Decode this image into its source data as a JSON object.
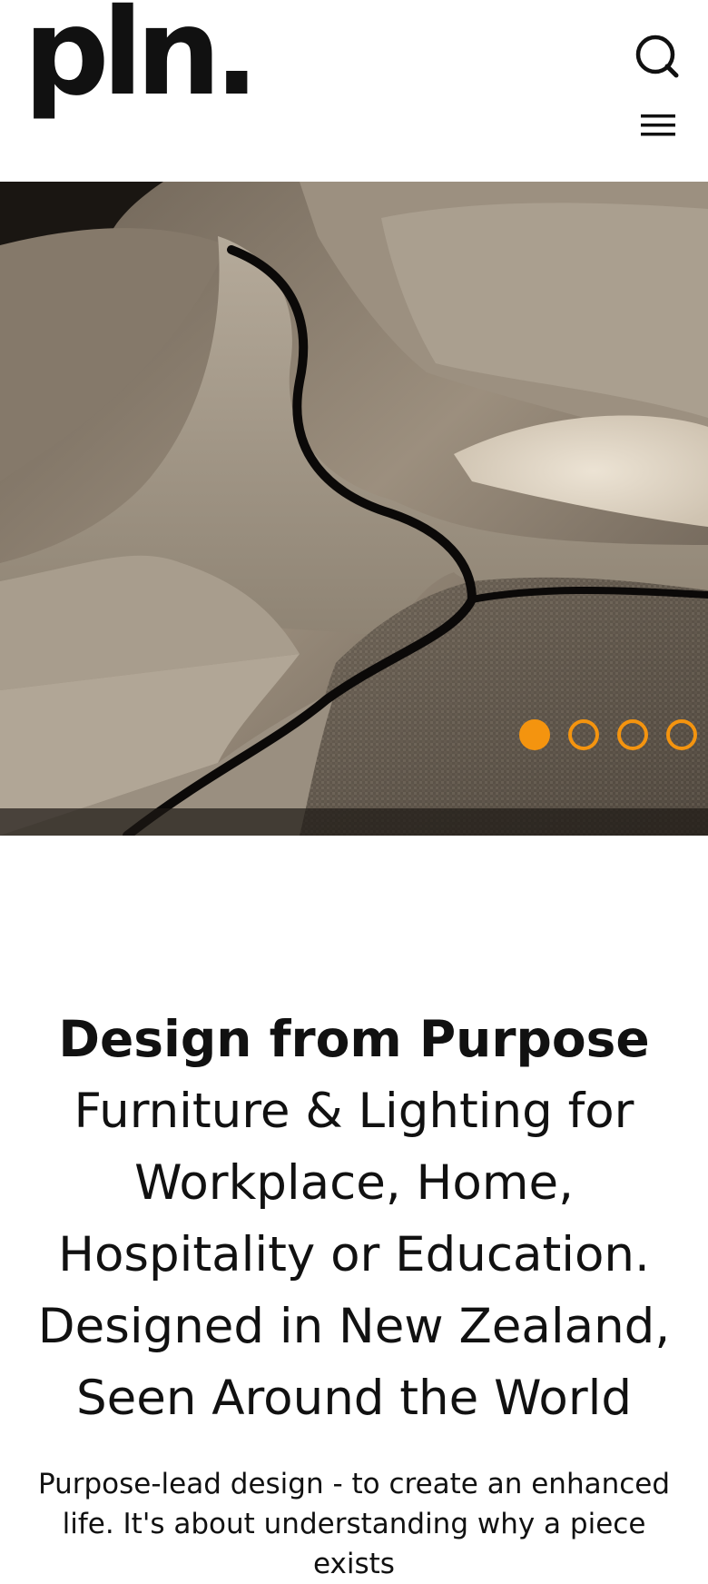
{
  "header": {
    "logo_text": "pln.",
    "search_icon": "search-icon",
    "menu_icon": "hamburger-menu-icon"
  },
  "hero": {
    "image_subject": "close-up of grey wool upholstered modular seating with black stitched seams",
    "slides_count": 4,
    "active_slide": 1,
    "accent_color": "#f4940f"
  },
  "content": {
    "headline": "Design from Purpose",
    "subheadline": "Furniture & Lighting for Workplace, Home, Hospitality or Education. Designed in New Zealand, Seen Around the World",
    "body": "Purpose-lead design - to create an enhanced life. It's about understanding why a piece exists"
  }
}
